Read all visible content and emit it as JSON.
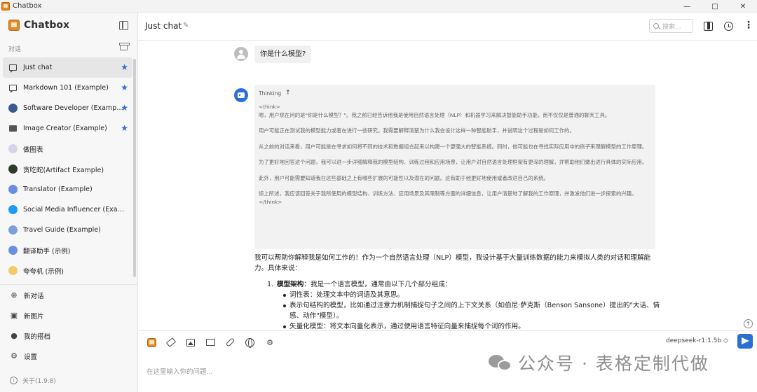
{
  "window": {
    "title": "Chatbox",
    "controls": [
      "—",
      "□",
      "✕"
    ]
  },
  "sidebar": {
    "brand": "Chatbox",
    "section_label": "对话",
    "items": [
      {
        "label": "Just chat",
        "icon": "chat-bubble-icon",
        "starred": true,
        "active": true
      },
      {
        "label": "Markdown 101 (Example)",
        "icon": "chat-bubble-icon",
        "starred": true
      },
      {
        "label": "Software Developer (Example)",
        "icon": "developer-avatar-icon",
        "starred": true
      },
      {
        "label": "Image Creator (Example)",
        "icon": "image-icon",
        "starred": true
      },
      {
        "label": "做图表",
        "icon": "chart-avatar-icon"
      },
      {
        "label": "贪吃蛇(Artifact Example)",
        "icon": "snake-avatar-icon"
      },
      {
        "label": "Translator (Example)",
        "icon": "translator-avatar-icon"
      },
      {
        "label": "Social Media Influencer (Example)",
        "icon": "twitter-avatar-icon"
      },
      {
        "label": "Travel Guide (Example)",
        "icon": "globe-avatar-icon"
      },
      {
        "label": "翻译助手 (示例)",
        "icon": "translator-avatar-icon"
      },
      {
        "label": "夸夸机 (示例)",
        "icon": "sparkle-avatar-icon"
      }
    ],
    "actions": [
      {
        "label": "新对话",
        "icon": "plus-circle-icon"
      },
      {
        "label": "新图片",
        "icon": "image-icon"
      },
      {
        "label": "我的搭档",
        "icon": "bot-icon"
      },
      {
        "label": "设置",
        "icon": "gear-icon"
      }
    ],
    "version": "关于(1.9.8)"
  },
  "header": {
    "title": "Just chat",
    "search_placeholder": "搜索..."
  },
  "conversation": {
    "user_message": "你是什么模型?",
    "thinking_label": "Thinking",
    "thinking_lines": [
      "<think>",
      "嗯，用户现在问的是\"你是什么模型？\"。我之前已经告诉他我是使用自然语言处理（NLP）和机器学习来解决智能助手功能，而不仅仅是普通的聊天工具。",
      "用户可能正在测试我的模型能力或者在进行一些研究。我需要解释清楚为什么我会设计这样一种智能助手，并说明这个过程是如何工作的。",
      "从之前的对话来看，用户可能是在寻求如何将不同的技术和数据组合起来以构建一个更强大的智能系统。同时，他可能也在寻找实际应用中的例子来理解模型的工作原理。",
      "为了更好地回答这个问题，我可以进一步详细解释我的模型结构、训练过程和应用场景，让用户对自然语言处理框架有更深的理解，并帮助他们做出进行具体的实际应用。",
      "此外，用户可能需要知道我在这些基础之上有哪些扩展的可能性以及潜在的问题。这有助于他更好地使用或者改进自己的系统。",
      "综上所述，我应该回答关于我所使用的模型结构、训练方法、应用场景及其限制等方面的详细信息，让用户清楚地了解我的工作原理，并激发他们进一步探索的兴趣。",
      "</think>"
    ],
    "answer_intro": "我可以帮助你解释我是如何工作的！作为一个自然语言处理（NLP）模型，我设计基于大量训练数据的能力来模拟人类的对话和理解能力。具体来说：",
    "answer_item": {
      "number": "1.",
      "title": "模型架构",
      "text": "：我是一个语言模型，通常由以下几个部分组成：",
      "bullets": [
        "词性表：处理文本中的词语及其意思。",
        "表示句结构的模型，比如通过注意力机制捕捉句子之间的上下文关系（如伯尼·萨克斯（Benson Sansone）提出的\"大话、情感、动作\"模型）。",
        "矢量化模型：将文本向量化表示，通过使用语言特征向量来捕捉每个词的作用。"
      ]
    }
  },
  "composer": {
    "placeholder": "在这里输入你的问题...",
    "model": "deepseek-r1:1.5b ◇"
  },
  "watermark": {
    "text": "公众号 · 表格定制代做"
  },
  "colors": {
    "accent": "#2a6fd6",
    "brand": "#e08a2a",
    "sidebar_bg": "#f7f7f7"
  }
}
